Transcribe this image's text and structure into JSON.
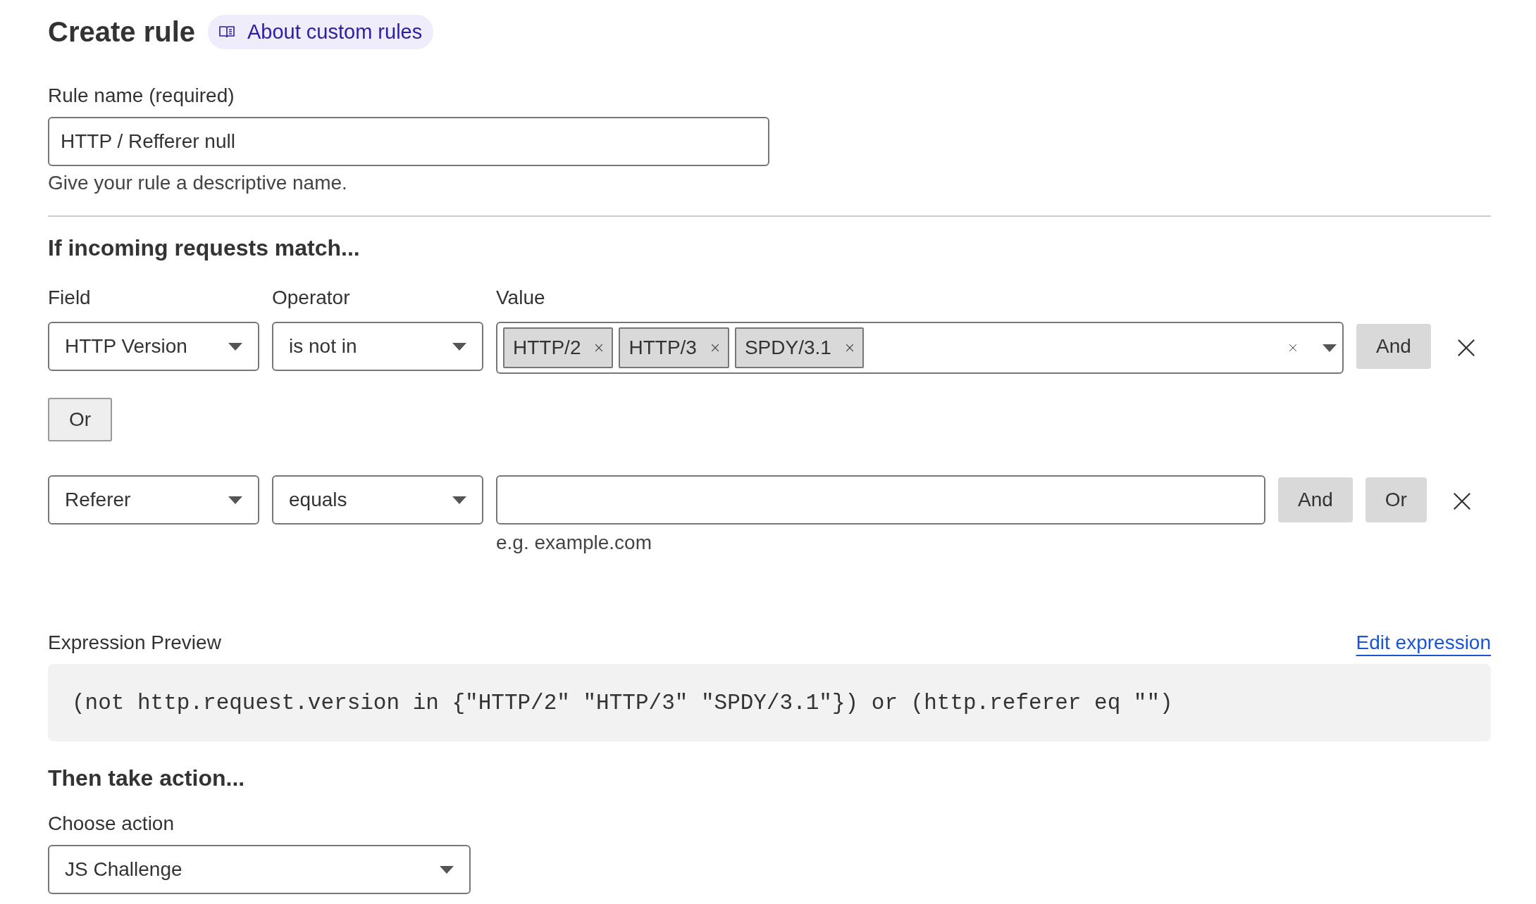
{
  "header": {
    "title": "Create rule",
    "help_link": "About custom rules"
  },
  "rule_name": {
    "label": "Rule name (required)",
    "value": "HTTP / Refferer null",
    "help": "Give your rule a descriptive name."
  },
  "match": {
    "heading": "If incoming requests match...",
    "columns": [
      "Field",
      "Operator",
      "Value"
    ],
    "rows": [
      {
        "kind": "condition",
        "field": "HTTP Version",
        "operator": "is not in",
        "value": {
          "kind": "tags",
          "tags": [
            "HTTP/2",
            "HTTP/3",
            "SPDY/3.1"
          ]
        },
        "buttons": [
          "And"
        ]
      },
      {
        "kind": "connector",
        "label": "Or"
      },
      {
        "kind": "condition",
        "field": "Referer",
        "operator": "equals",
        "value": {
          "kind": "text",
          "hint": "e.g. example.com"
        },
        "buttons": [
          "And",
          "Or"
        ]
      }
    ]
  },
  "expression": {
    "label": "Expression Preview",
    "edit_link": "Edit expression",
    "code": "(not http.request.version in {\"HTTP/2\" \"HTTP/3\" \"SPDY/3.1\"}) or (http.referer eq \"\")"
  },
  "action": {
    "heading": "Then take action...",
    "label": "Choose action",
    "value": "JS Challenge"
  }
}
